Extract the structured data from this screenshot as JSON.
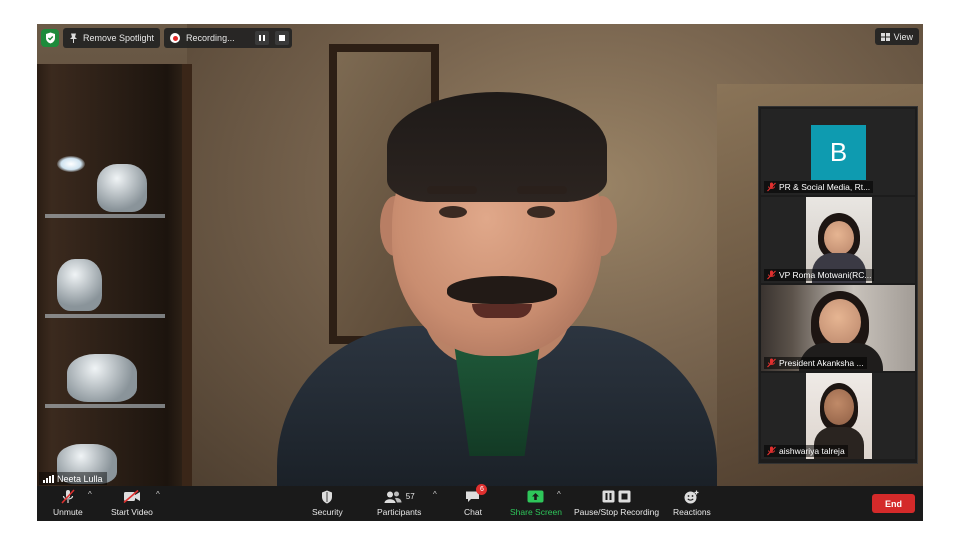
{
  "top_overlay": {
    "spotlight_label": "Remove Spotlight",
    "recording_label": "Recording...",
    "view_label": "View"
  },
  "speaker": {
    "name": "Neeta Lulla"
  },
  "gallery": [
    {
      "name": "PR & Social Media, Rt...",
      "avatar_letter": "B",
      "avatar_color": "#0e9bb0"
    },
    {
      "name": "VP Roma Motwani(RC..."
    },
    {
      "name": "President Akanksha ..."
    },
    {
      "name": "aishwariya talreja"
    }
  ],
  "toolbar": {
    "unmute": "Unmute",
    "start_video": "Start Video",
    "security": "Security",
    "participants": "Participants",
    "participants_count": "57",
    "chat": "Chat",
    "chat_badge": "6",
    "share_screen": "Share Screen",
    "pause_stop_recording": "Pause/Stop Recording",
    "reactions": "Reactions",
    "end": "End"
  },
  "colors": {
    "share_green": "#2ec65a",
    "end_red": "#d42a2a",
    "security_green": "#1d8a3b"
  }
}
